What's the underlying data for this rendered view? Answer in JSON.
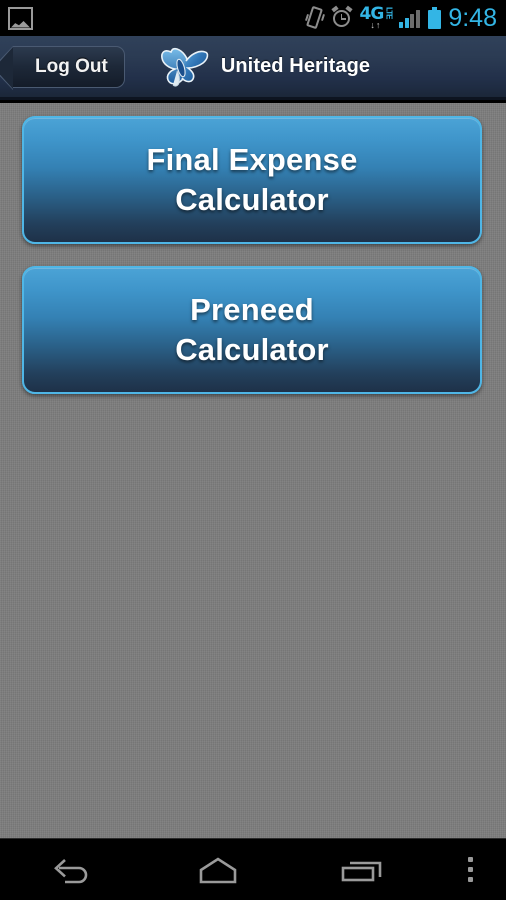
{
  "status_bar": {
    "notification_icon": "gallery-image-icon",
    "icons": [
      "vibrate-icon",
      "alarm-clock-icon",
      "4g-lte-icon",
      "signal-bars-icon",
      "battery-icon"
    ],
    "network_label": "4G",
    "network_tech": "LTE",
    "data_arrows": "↓↑",
    "signal_bars_filled": 2,
    "signal_bars_total": 4,
    "clock": "9:48",
    "accent_color": "#33b5e5",
    "background_color": "#000000"
  },
  "header": {
    "logout_label": "Log Out",
    "brand_title": "United Heritage",
    "logo_icon": "butterfly-logo-icon",
    "background_top_color": "#30415a",
    "background_bottom_color": "#1b2739",
    "title_color": "#ffffff"
  },
  "main": {
    "background_color": "#7d7d7d",
    "buttons": [
      {
        "name": "final-expense-calculator",
        "line1": "Final Expense",
        "line2": "Calculator"
      },
      {
        "name": "preneed-calculator",
        "line1": "Preneed",
        "line2": "Calculator"
      }
    ],
    "button_top_color": "#4ba3d6",
    "button_bottom_color": "#1e3148",
    "button_border_color": "#4fb6e6",
    "button_text_color": "#ffffff"
  },
  "nav_bar": {
    "items": [
      {
        "name": "back-button",
        "icon": "back-arrow-icon"
      },
      {
        "name": "home-button",
        "icon": "home-icon"
      },
      {
        "name": "recents-button",
        "icon": "recent-apps-icon"
      },
      {
        "name": "menu-button",
        "icon": "overflow-menu-icon"
      }
    ],
    "icon_color": "#9a9a9a",
    "background_color": "#000000"
  }
}
